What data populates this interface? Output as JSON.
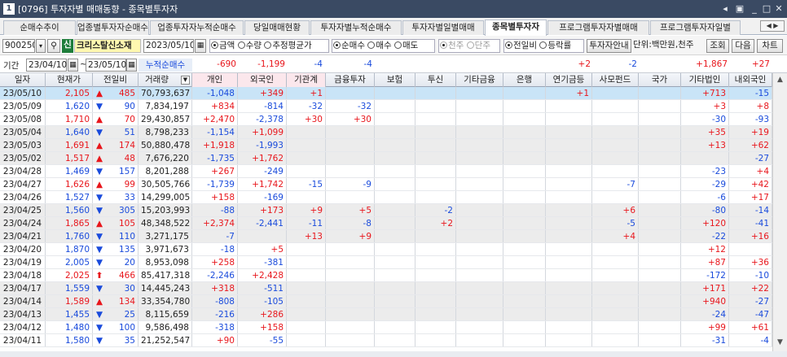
{
  "window": {
    "id": "0796",
    "title": "[0796] 투자자별 매매동향 - 종목별투자자"
  },
  "tabs": [
    "순매수추이",
    "업종별투자자순매수",
    "업종투자자누적순매수",
    "당일매매현황",
    "투자자별누적순매수",
    "투자자별일별매매",
    "종목별투자자",
    "프로그램투자자별매매",
    "프로그램투자자일별"
  ],
  "active_tab": "종목별투자자",
  "toolbar": {
    "code": "900250",
    "sin": "신",
    "stock_name": "크리스탈신소재",
    "date": "2023/05/10",
    "r1": [
      "금액",
      "수량",
      "추정평균가"
    ],
    "r2": [
      "순매수",
      "매수",
      "매도"
    ],
    "r3": [
      "천주",
      "단주"
    ],
    "r4": [
      "전일비",
      "등락률"
    ],
    "investor_btn": "투자자안내",
    "unit": "단위:백만원,천주",
    "query_btn": "조회",
    "next_btn": "다음",
    "chart_btn": "차트"
  },
  "period": {
    "label": "기간",
    "from": "23/04/10",
    "sep": "~",
    "to": "23/05/10",
    "cum_label": "누적순매수"
  },
  "summary": {
    "individual": "-690",
    "foreign": "-1,199",
    "institution": "-4",
    "finance": "-4",
    "insurance": "",
    "trust": "",
    "other_fin": "",
    "bank": "",
    "pension": "+2",
    "pef": "-2",
    "nation": "",
    "other_corp": "+1,867",
    "domestic_foreign": "+27"
  },
  "columns": [
    "일자",
    "현재가",
    "전일비",
    "거래량",
    "개인",
    "외국인",
    "기관계",
    "금융투자",
    "보험",
    "투신",
    "기타금융",
    "은행",
    "연기금등",
    "사모펀드",
    "국가",
    "기타법인",
    "내외국인"
  ],
  "rows": [
    {
      "d": "23/05/10",
      "p": "2,105",
      "dir": "up",
      "ch": "485",
      "v": "70,793,637",
      "ind": "-1,048",
      "frn": "+349",
      "ins": "+1",
      "fin": "",
      "isr": "",
      "tru": "",
      "ofn": "",
      "bnk": "",
      "pen": "+1",
      "pef": "",
      "nat": "",
      "oc": "+713",
      "df": "-15"
    },
    {
      "d": "23/05/09",
      "p": "1,620",
      "dir": "dn",
      "ch": "90",
      "v": "7,834,197",
      "ind": "+834",
      "frn": "-814",
      "ins": "-32",
      "fin": "-32",
      "isr": "",
      "tru": "",
      "ofn": "",
      "bnk": "",
      "pen": "",
      "pef": "",
      "nat": "",
      "oc": "+3",
      "df": "+8"
    },
    {
      "d": "23/05/08",
      "p": "1,710",
      "dir": "up",
      "ch": "70",
      "v": "29,430,857",
      "ind": "+2,470",
      "frn": "-2,378",
      "ins": "+30",
      "fin": "+30",
      "isr": "",
      "tru": "",
      "ofn": "",
      "bnk": "",
      "pen": "",
      "pef": "",
      "nat": "",
      "oc": "-30",
      "df": "-93"
    },
    {
      "d": "23/05/04",
      "p": "1,640",
      "dir": "dn",
      "ch": "51",
      "v": "8,798,233",
      "ind": "-1,154",
      "frn": "+1,099",
      "ins": "",
      "fin": "",
      "isr": "",
      "tru": "",
      "ofn": "",
      "bnk": "",
      "pen": "",
      "pef": "",
      "nat": "",
      "oc": "+35",
      "df": "+19"
    },
    {
      "d": "23/05/03",
      "p": "1,691",
      "dir": "up",
      "ch": "174",
      "v": "50,880,478",
      "ind": "+1,918",
      "frn": "-1,993",
      "ins": "",
      "fin": "",
      "isr": "",
      "tru": "",
      "ofn": "",
      "bnk": "",
      "pen": "",
      "pef": "",
      "nat": "",
      "oc": "+13",
      "df": "+62"
    },
    {
      "d": "23/05/02",
      "p": "1,517",
      "dir": "up",
      "ch": "48",
      "v": "7,676,220",
      "ind": "-1,735",
      "frn": "+1,762",
      "ins": "",
      "fin": "",
      "isr": "",
      "tru": "",
      "ofn": "",
      "bnk": "",
      "pen": "",
      "pef": "",
      "nat": "",
      "oc": "",
      "df": "-27"
    },
    {
      "d": "23/04/28",
      "p": "1,469",
      "dir": "dn",
      "ch": "157",
      "v": "8,201,288",
      "ind": "+267",
      "frn": "-249",
      "ins": "",
      "fin": "",
      "isr": "",
      "tru": "",
      "ofn": "",
      "bnk": "",
      "pen": "",
      "pef": "",
      "nat": "",
      "oc": "-23",
      "df": "+4"
    },
    {
      "d": "23/04/27",
      "p": "1,626",
      "dir": "up",
      "ch": "99",
      "v": "30,505,766",
      "ind": "-1,739",
      "frn": "+1,742",
      "ins": "-15",
      "fin": "-9",
      "isr": "",
      "tru": "",
      "ofn": "",
      "bnk": "",
      "pen": "",
      "pef": "-7",
      "nat": "",
      "oc": "-29",
      "df": "+42"
    },
    {
      "d": "23/04/26",
      "p": "1,527",
      "dir": "dn",
      "ch": "33",
      "v": "14,299,005",
      "ind": "+158",
      "frn": "-169",
      "ins": "",
      "fin": "",
      "isr": "",
      "tru": "",
      "ofn": "",
      "bnk": "",
      "pen": "",
      "pef": "",
      "nat": "",
      "oc": "-6",
      "df": "+17"
    },
    {
      "d": "23/04/25",
      "p": "1,560",
      "dir": "dn",
      "ch": "305",
      "v": "15,203,993",
      "ind": "-88",
      "frn": "+173",
      "ins": "+9",
      "fin": "+5",
      "isr": "",
      "tru": "-2",
      "ofn": "",
      "bnk": "",
      "pen": "",
      "pef": "+6",
      "nat": "",
      "oc": "-80",
      "df": "-14"
    },
    {
      "d": "23/04/24",
      "p": "1,865",
      "dir": "up",
      "ch": "105",
      "v": "48,348,522",
      "ind": "+2,374",
      "frn": "-2,441",
      "ins": "-11",
      "fin": "-8",
      "isr": "",
      "tru": "+2",
      "ofn": "",
      "bnk": "",
      "pen": "",
      "pef": "-5",
      "nat": "",
      "oc": "+120",
      "df": "-41"
    },
    {
      "d": "23/04/21",
      "p": "1,760",
      "dir": "dn",
      "ch": "110",
      "v": "3,271,175",
      "ind": "-7",
      "frn": "",
      "ins": "+13",
      "fin": "+9",
      "isr": "",
      "tru": "",
      "ofn": "",
      "bnk": "",
      "pen": "",
      "pef": "+4",
      "nat": "",
      "oc": "-22",
      "df": "+16"
    },
    {
      "d": "23/04/20",
      "p": "1,870",
      "dir": "dn",
      "ch": "135",
      "v": "3,971,673",
      "ind": "-18",
      "frn": "+5",
      "ins": "",
      "fin": "",
      "isr": "",
      "tru": "",
      "ofn": "",
      "bnk": "",
      "pen": "",
      "pef": "",
      "nat": "",
      "oc": "+12",
      "df": ""
    },
    {
      "d": "23/04/19",
      "p": "2,005",
      "dir": "dn",
      "ch": "20",
      "v": "8,953,098",
      "ind": "+258",
      "frn": "-381",
      "ins": "",
      "fin": "",
      "isr": "",
      "tru": "",
      "ofn": "",
      "bnk": "",
      "pen": "",
      "pef": "",
      "nat": "",
      "oc": "+87",
      "df": "+36"
    },
    {
      "d": "23/04/18",
      "p": "2,025",
      "dir": "uu",
      "ch": "466",
      "v": "85,417,318",
      "ind": "-2,246",
      "frn": "+2,428",
      "ins": "",
      "fin": "",
      "isr": "",
      "tru": "",
      "ofn": "",
      "bnk": "",
      "pen": "",
      "pef": "",
      "nat": "",
      "oc": "-172",
      "df": "-10"
    },
    {
      "d": "23/04/17",
      "p": "1,559",
      "dir": "dn",
      "ch": "30",
      "v": "14,445,243",
      "ind": "+318",
      "frn": "-511",
      "ins": "",
      "fin": "",
      "isr": "",
      "tru": "",
      "ofn": "",
      "bnk": "",
      "pen": "",
      "pef": "",
      "nat": "",
      "oc": "+171",
      "df": "+22"
    },
    {
      "d": "23/04/14",
      "p": "1,589",
      "dir": "up",
      "ch": "134",
      "v": "33,354,780",
      "ind": "-808",
      "frn": "-105",
      "ins": "",
      "fin": "",
      "isr": "",
      "tru": "",
      "ofn": "",
      "bnk": "",
      "pen": "",
      "pef": "",
      "nat": "",
      "oc": "+940",
      "df": "-27"
    },
    {
      "d": "23/04/13",
      "p": "1,455",
      "dir": "dn",
      "ch": "25",
      "v": "8,115,659",
      "ind": "-216",
      "frn": "+286",
      "ins": "",
      "fin": "",
      "isr": "",
      "tru": "",
      "ofn": "",
      "bnk": "",
      "pen": "",
      "pef": "",
      "nat": "",
      "oc": "-24",
      "df": "-47"
    },
    {
      "d": "23/04/12",
      "p": "1,480",
      "dir": "dn",
      "ch": "100",
      "v": "9,586,498",
      "ind": "-318",
      "frn": "+158",
      "ins": "",
      "fin": "",
      "isr": "",
      "tru": "",
      "ofn": "",
      "bnk": "",
      "pen": "",
      "pef": "",
      "nat": "",
      "oc": "+99",
      "df": "+61"
    },
    {
      "d": "23/04/11",
      "p": "1,580",
      "dir": "dn",
      "ch": "35",
      "v": "21,252,547",
      "ind": "+90",
      "frn": "-55",
      "ins": "",
      "fin": "",
      "isr": "",
      "tru": "",
      "ofn": "",
      "bnk": "",
      "pen": "",
      "pef": "",
      "nat": "",
      "oc": "-31",
      "df": "-4"
    }
  ],
  "colors": {
    "up": "#e8161c",
    "down": "#1a4bdc",
    "selected_row": "#c9e4f7",
    "titlebar": "#3a4a63"
  }
}
